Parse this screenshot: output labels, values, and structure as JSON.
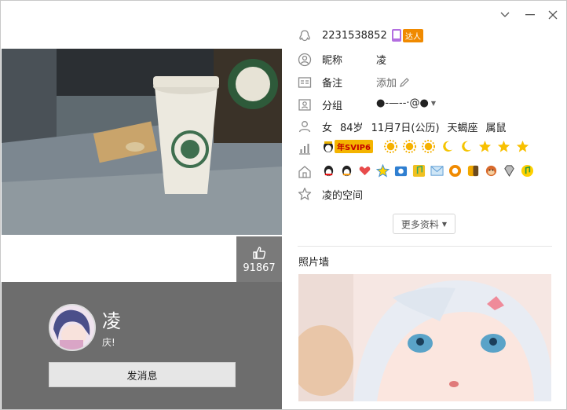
{
  "window": {
    "controls": [
      "chevron-down-icon",
      "minimize-icon",
      "close-icon"
    ]
  },
  "profile": {
    "qq_number": "2231538852",
    "nickname_label": "昵称",
    "nickname": "凌",
    "remark_label": "备注",
    "remark_action": "添加",
    "group_label": "分组",
    "group_value": "●-—--·@●",
    "gender": "女",
    "age": "84岁",
    "birthday": "11月7日(公历)",
    "zodiac": "天蝎座",
    "chinese_zodiac": "属鼠",
    "vip_text": "年SVIP6",
    "space_name": "凌的空间",
    "more_info": "更多资料",
    "talent_badge": "达人"
  },
  "card": {
    "likes": "91867",
    "name": "凌",
    "signature": "庆!",
    "send_message": "发消息"
  },
  "photo_wall": {
    "title": "照片墙"
  },
  "colors": {
    "dark_panel": "#6d6d6d",
    "like_box": "#7a7a7a",
    "sun": "#f5b100",
    "moon": "#f5c400",
    "star": "#f8c000"
  }
}
